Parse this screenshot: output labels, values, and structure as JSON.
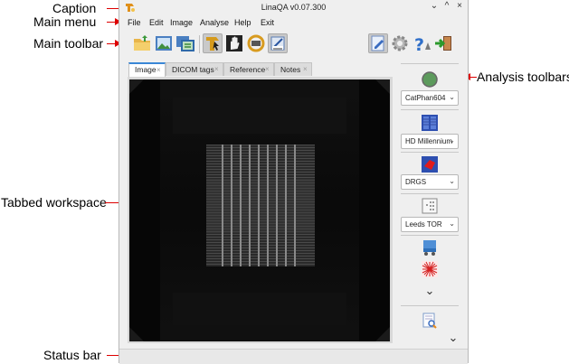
{
  "annotations": {
    "caption": "Caption",
    "main_menu": "Main menu",
    "main_toolbar": "Main toolbar",
    "tabbed_workspace": "Tabbed workspace",
    "status_bar": "Status bar",
    "analysis_toolbars": "Analysis toolbars"
  },
  "window": {
    "title": "LinaQA v0.07.300",
    "controls": {
      "minimize": "⌄",
      "maximize": "^",
      "close": "×"
    }
  },
  "menu": {
    "items": [
      "File",
      "Edit",
      "Image",
      "Analyse",
      "Help",
      "Exit"
    ]
  },
  "toolbar": {
    "icons": [
      "open-folder-icon",
      "image-icon",
      "image-stack-icon",
      "cursor-icon",
      "hand-icon",
      "ring-icon",
      "dicom-icon",
      "edit-icon",
      "settings-gear-icon",
      "help-icon",
      "exit-icon"
    ]
  },
  "tabs": [
    {
      "label": "Image",
      "active": true
    },
    {
      "label": "DICOM tags",
      "active": false
    },
    {
      "label": "Reference",
      "active": false
    },
    {
      "label": "Notes",
      "active": false
    }
  ],
  "tab_close_glyph": "×",
  "analysis": {
    "combos": [
      {
        "value": "CatPhan604"
      },
      {
        "value": "HD Millennium"
      },
      {
        "value": "DRGS"
      },
      {
        "value": "Leeds TOR"
      }
    ],
    "combo_arrow": "⌄",
    "expand_glyph": "⌄"
  },
  "colors": {
    "accent": "#3a87d6",
    "arrow": "#dd0000",
    "image_bg": "#050505"
  }
}
